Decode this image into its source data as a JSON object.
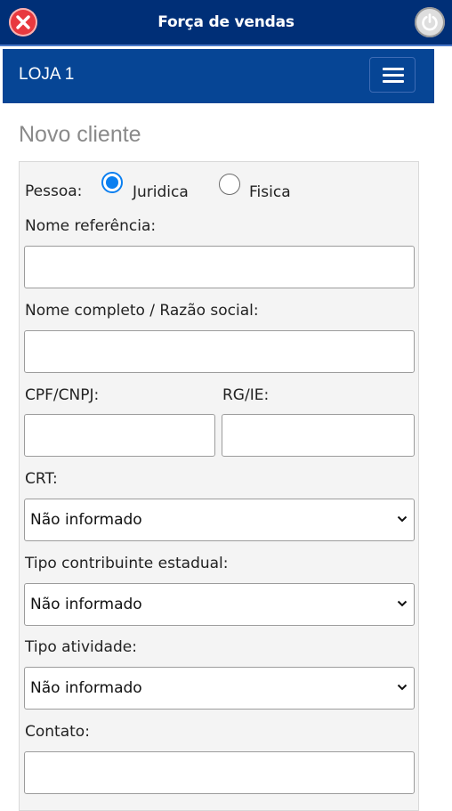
{
  "header": {
    "title": "Força de vendas",
    "close_icon": "close-circle-icon",
    "power_icon": "power-icon",
    "colors": {
      "bar": "#002f77",
      "close": "#e8393f",
      "power": "#dedede"
    }
  },
  "navbar": {
    "store": "LOJA 1",
    "menu_icon": "hamburger-menu-icon",
    "color": "#064595"
  },
  "page": {
    "title": "Novo cliente"
  },
  "form": {
    "pessoa": {
      "label": "Pessoa:",
      "options": [
        {
          "label": "Juridica",
          "selected": true
        },
        {
          "label": "Fisica",
          "selected": false
        }
      ]
    },
    "nome_referencia": {
      "label": "Nome referência:",
      "value": ""
    },
    "nome_completo": {
      "label": "Nome completo / Razão social:",
      "value": ""
    },
    "cpf_cnpj": {
      "label": "CPF/CNPJ:",
      "value": ""
    },
    "rg_ie": {
      "label": "RG/IE:",
      "value": ""
    },
    "crt": {
      "label": "CRT:",
      "value": "Não informado"
    },
    "tipo_contribuinte": {
      "label": "Tipo contribuinte estadual:",
      "value": "Não informado"
    },
    "tipo_atividade": {
      "label": "Tipo atividade:",
      "value": "Não informado"
    },
    "contato": {
      "label": "Contato:",
      "value": ""
    },
    "accent_color": "#0a7ff0"
  }
}
